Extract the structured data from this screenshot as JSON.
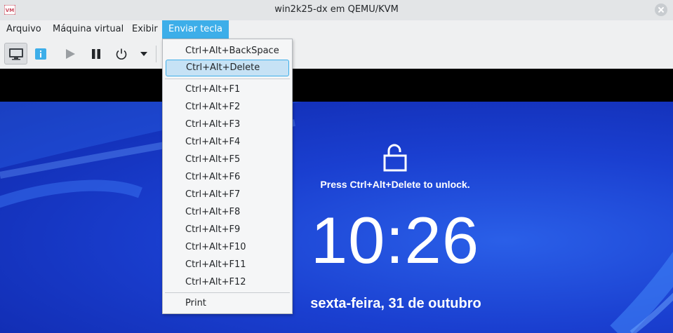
{
  "window": {
    "title": "win2k25-dx em QEMU/KVM"
  },
  "menubar": {
    "items": [
      "Arquivo",
      "Máquina virtual",
      "Exibir",
      "Enviar tecla"
    ]
  },
  "toolbar": {
    "buttons": [
      "console-icon",
      "info-icon",
      "play-icon",
      "pause-icon",
      "power-icon",
      "chevron-down-icon"
    ]
  },
  "send_key_menu": {
    "items": [
      "Ctrl+Alt+BackSpace",
      "Ctrl+Alt+Delete",
      "Ctrl+Alt+F1",
      "Ctrl+Alt+F2",
      "Ctrl+Alt+F3",
      "Ctrl+Alt+F4",
      "Ctrl+Alt+F5",
      "Ctrl+Alt+F6",
      "Ctrl+Alt+F7",
      "Ctrl+Alt+F8",
      "Ctrl+Alt+F9",
      "Ctrl+Alt+F10",
      "Ctrl+Alt+F11",
      "Ctrl+Alt+F12",
      "Print"
    ],
    "selected": "Ctrl+Alt+Delete"
  },
  "lock_screen": {
    "hint": "Press Ctrl+Alt+Delete to unlock.",
    "time": "10:26",
    "date": "sexta-feira, 31 de outubro"
  },
  "colors": {
    "accent": "#3daee9",
    "lock_bg": "#1a3fd0"
  }
}
